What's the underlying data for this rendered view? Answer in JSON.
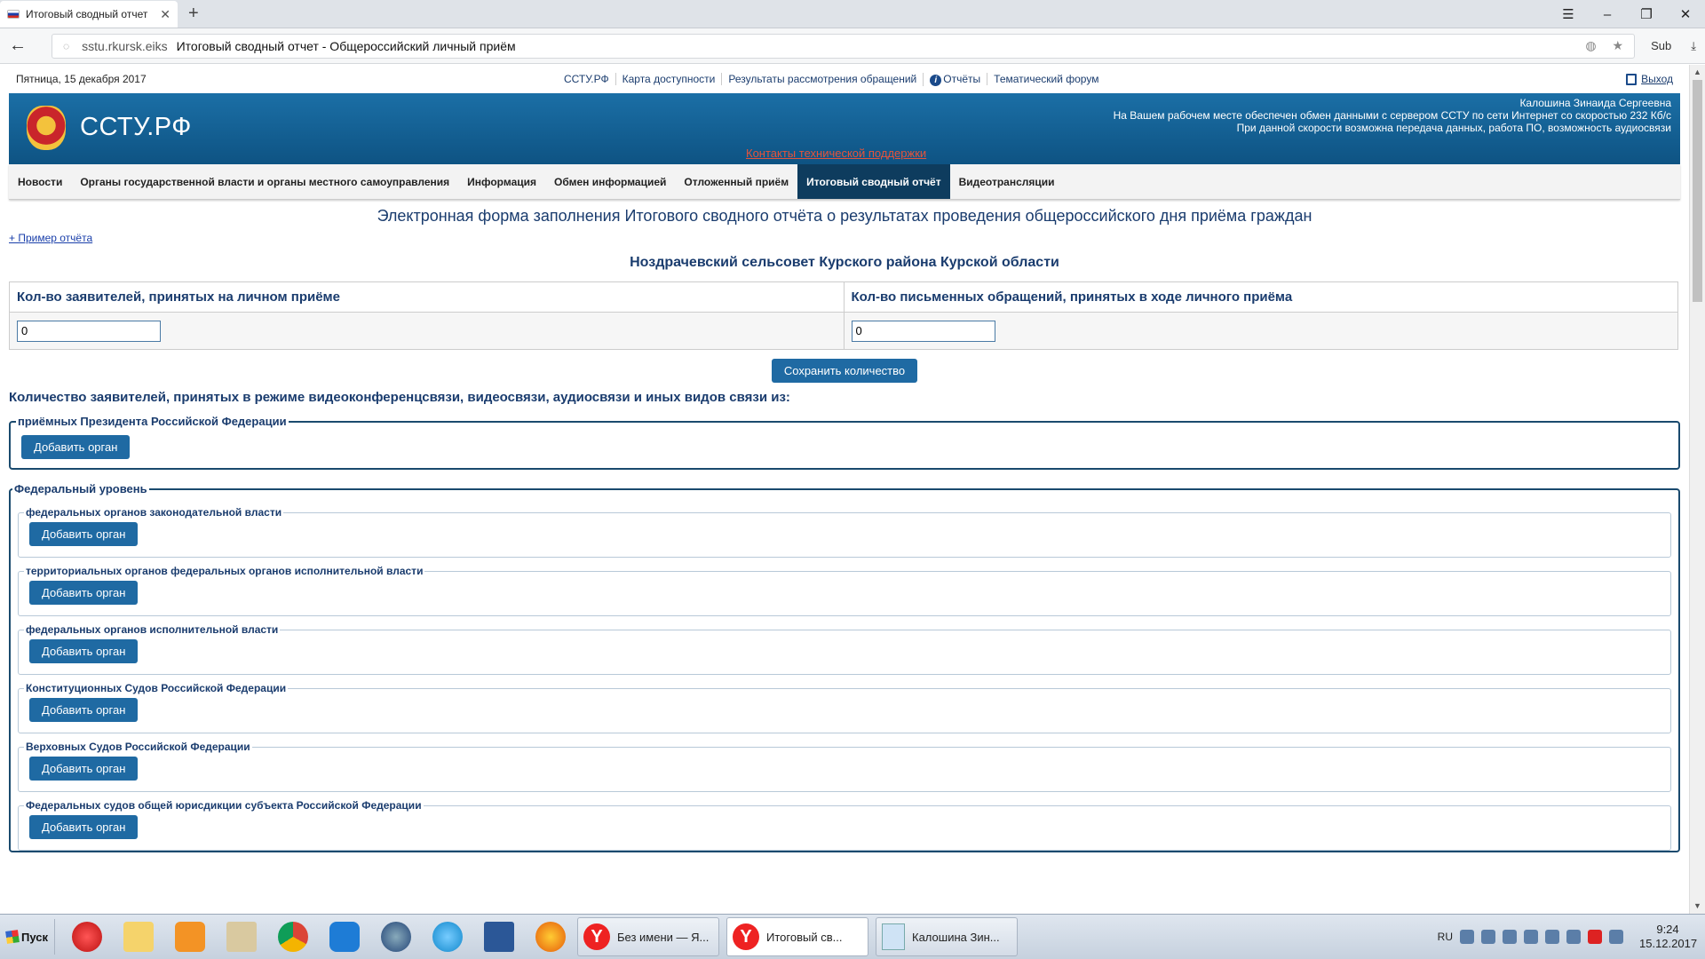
{
  "browser": {
    "tab_title": "Итоговый сводный отчет",
    "url_host": "sstu.rkursk.eiks",
    "url_title": "Итоговый сводный отчет - Общероссийский личный приём",
    "sub_label": "Sub"
  },
  "site": {
    "date": "Пятница, 15 декабря 2017",
    "top_links": [
      "ССТУ.РФ",
      "Карта доступности",
      "Результаты рассмотрения обращений",
      "Отчёты",
      "Тематический форум"
    ],
    "logout": "Выход",
    "logo": "ССТУ.РФ",
    "user_name": "Калошина Зинаида Сергеевна",
    "user_line1": "На Вашем рабочем месте обеспечен обмен данными с сервером ССТУ по сети Интернет со скоростью 232 Кб/с",
    "user_line2": "При данной скорости возможна передача данных, работа ПО, возможность аудиосвязи",
    "support": "Контакты технической поддержки",
    "nav": [
      "Новости",
      "Органы государственной власти и органы местного самоуправления",
      "Информация",
      "Обмен информацией",
      "Отложенный приём",
      "Итоговый сводный отчёт",
      "Видеотрансляции"
    ],
    "nav_active_index": 5
  },
  "form": {
    "title": "Электронная форма заполнения Итогового сводного отчёта о результатах проведения общероссийского дня приёма граждан",
    "example_link": "+ Пример отчёта",
    "org": "Ноздрачевский сельсовет Курского района Курской области",
    "col1_header": "Кол-во заявителей, принятых на личном приёме",
    "col2_header": "Кол-во письменных обращений, принятых в ходе личного приёма",
    "col1_value": "0",
    "col2_value": "0",
    "save_button": "Сохранить количество",
    "remote_label": "Количество заявителей, принятых в режиме видеоконференцсвязи, видеосвязи, аудиосвязи и иных видов связи из:",
    "president_legend": "приёмных Президента Российской Федерации",
    "add_button": "Добавить орган",
    "federal_legend": "Федеральный уровень",
    "federal_sections": [
      "федеральных органов законодательной власти",
      "территориальных органов федеральных органов исполнительной власти",
      "федеральных органов исполнительной власти",
      "Конституционных Судов Российской Федерации",
      "Верховных Судов Российской Федерации",
      "Федеральных судов общей юрисдикции субъекта Российской Федерации"
    ]
  },
  "taskbar": {
    "start": "Пуск",
    "buttons": [
      "Без имени — Я...",
      "Итоговый св...",
      "Калошина Зин..."
    ],
    "lang": "RU",
    "time": "9:24",
    "date": "15.12.2017"
  }
}
